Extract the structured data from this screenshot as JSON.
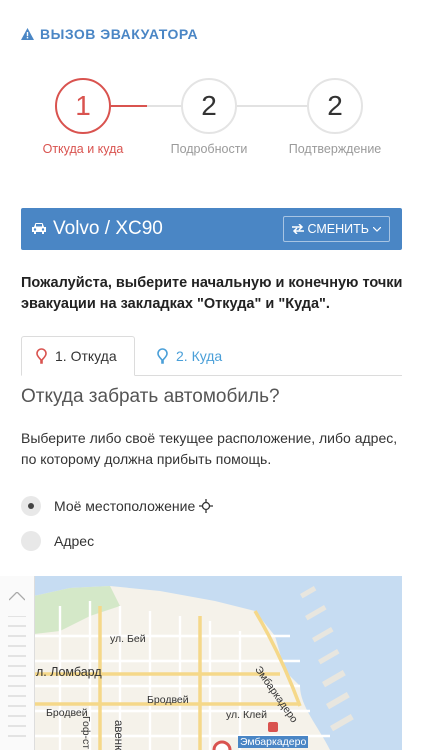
{
  "header": {
    "title": "ВЫЗОВ ЭВАКУАТОРА",
    "icon": "warning-icon"
  },
  "steps": [
    {
      "number": "1",
      "label": "Откуда и куда",
      "active": true
    },
    {
      "number": "2",
      "label": "Подробности",
      "active": false
    },
    {
      "number": "2",
      "label": "Подтверждение",
      "active": false
    }
  ],
  "car": {
    "name": "Volvo / XC90",
    "change_label": "СМЕНИТЬ"
  },
  "instruction": "Пожалуйста, выберите начальную и конечную точки эвакуации на закладках \"Откуда\" и \"Куда\".",
  "tabs": [
    {
      "label": "1. Откуда",
      "active": true
    },
    {
      "label": "2. Куда",
      "active": false
    }
  ],
  "question": "Откуда забрать автомобиль?",
  "description": "Выберите либо своё текущее расположение, либо адрес, по которому должна прибыть помощь.",
  "options": [
    {
      "label": "Моё местоположение",
      "selected": true
    },
    {
      "label": "Адрес",
      "selected": false
    }
  ],
  "map": {
    "labels": [
      "ул. Бей",
      "л. Ломбард",
      "Бродвей",
      "Бродвей",
      "ул. Клей",
      "Эмбаркадеро",
      "Эмбаркадеро",
      "Гоф-ст",
      "авеню"
    ]
  },
  "colors": {
    "accent": "#4a86c5",
    "active_step": "#d9534f",
    "tab_link": "#4a9fd8"
  }
}
